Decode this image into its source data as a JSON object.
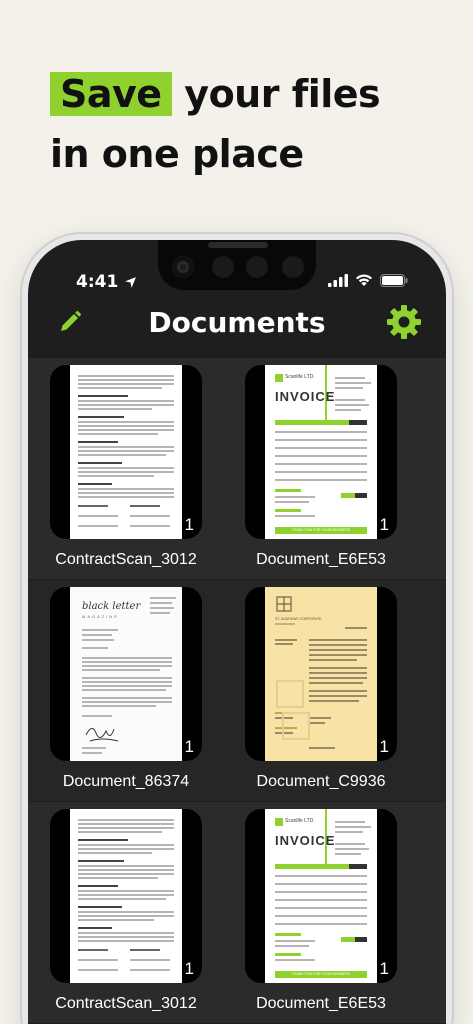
{
  "promo": {
    "highlight": "Save",
    "line1_rest": " your files",
    "line2": "in one place"
  },
  "status": {
    "time": "4:41"
  },
  "header": {
    "title": "Documents"
  },
  "documents": [
    {
      "name": "ContractScan_3012",
      "pages": "1",
      "kind": "contract"
    },
    {
      "name": "Document_E6E53",
      "pages": "1",
      "kind": "invoice"
    },
    {
      "name": "Document_86374",
      "pages": "1",
      "kind": "letter"
    },
    {
      "name": "Document_C9936",
      "pages": "1",
      "kind": "letterhead"
    },
    {
      "name": "ContractScan_3012",
      "pages": "1",
      "kind": "contract"
    },
    {
      "name": "Document_E6E53",
      "pages": "1",
      "kind": "invoice"
    }
  ],
  "thumb_text": {
    "invoice_title": "INVOICE",
    "invoice_company": "Scanlife LTD.",
    "invoice_footer": "THANK YOU FOR YOUR BUSINESS",
    "letter_brand": "black letter",
    "letter_sub": "MAGAZINE",
    "letterhead_brand": "ST. ANDREWS CORPORATE"
  },
  "colors": {
    "accent": "#8fd22f",
    "background": "#1e1e1e"
  }
}
